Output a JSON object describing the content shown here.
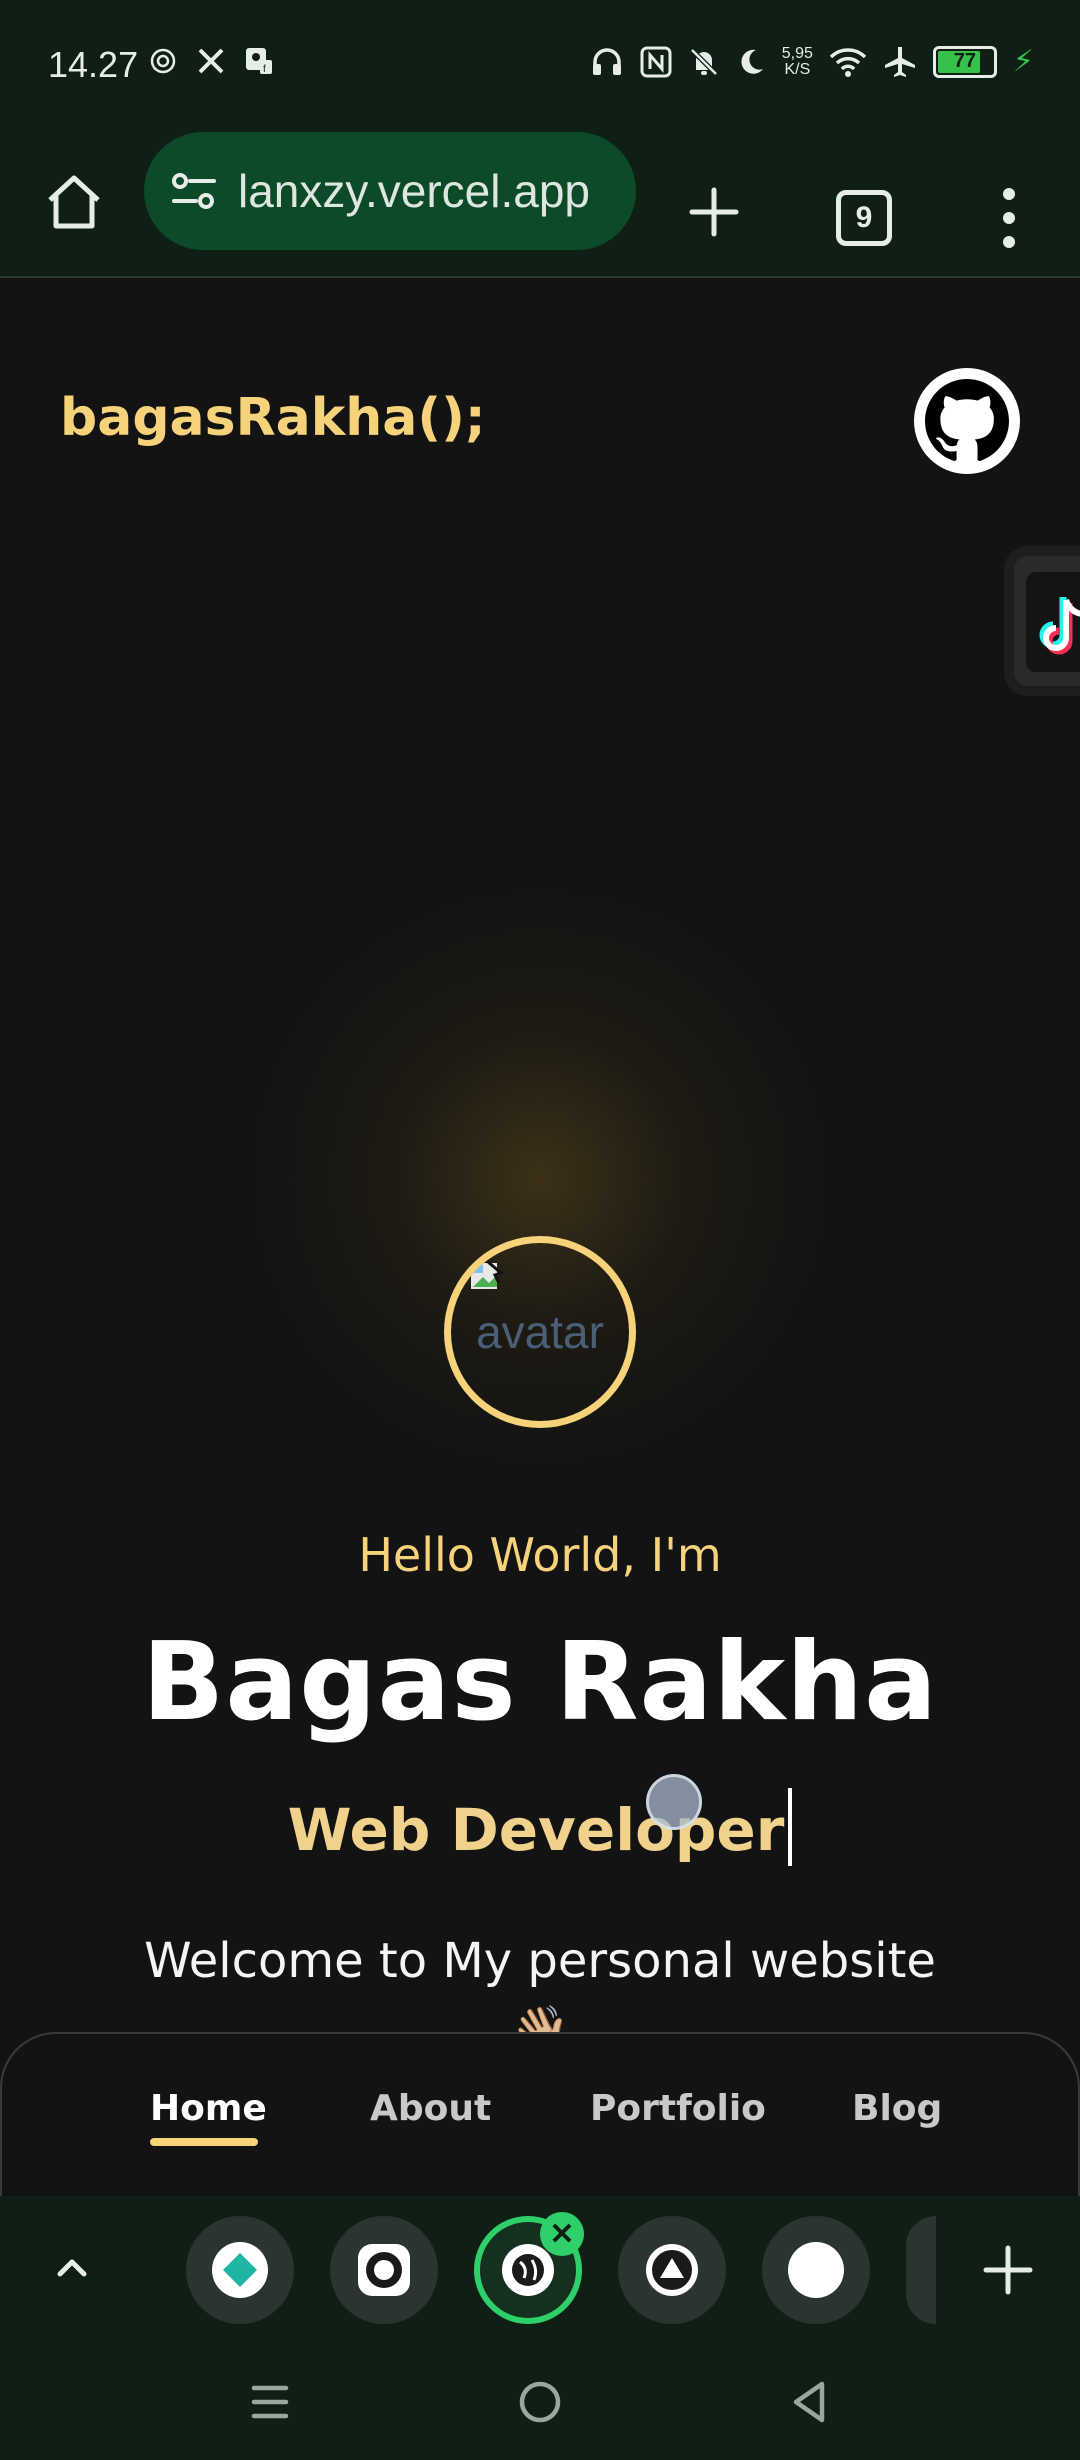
{
  "status_bar": {
    "time": "14.27",
    "net_speed_value": "5,95",
    "net_speed_unit": "K/S",
    "battery": "77",
    "battery_level": 0.77
  },
  "browser": {
    "url": "lanxzy.vercel.app",
    "tab_count": "9"
  },
  "site": {
    "brand": "bagasRakha();",
    "avatar_alt": "avatar",
    "greeting": "Hello World, I'm",
    "name": "Bagas Rakha",
    "role": "Web Developer",
    "welcome": "Welcome to My personal website 👋🏼"
  },
  "site_nav": {
    "items": [
      {
        "label": "Home"
      },
      {
        "label": "About"
      },
      {
        "label": "Portfolio"
      },
      {
        "label": "Blog"
      }
    ],
    "active": "Home"
  },
  "colors": {
    "accent": "#f6d37a",
    "background": "#131313",
    "browser_chrome": "#0f1f16",
    "url_bar": "#0c4a28",
    "active_tab": "#2fd06a"
  }
}
